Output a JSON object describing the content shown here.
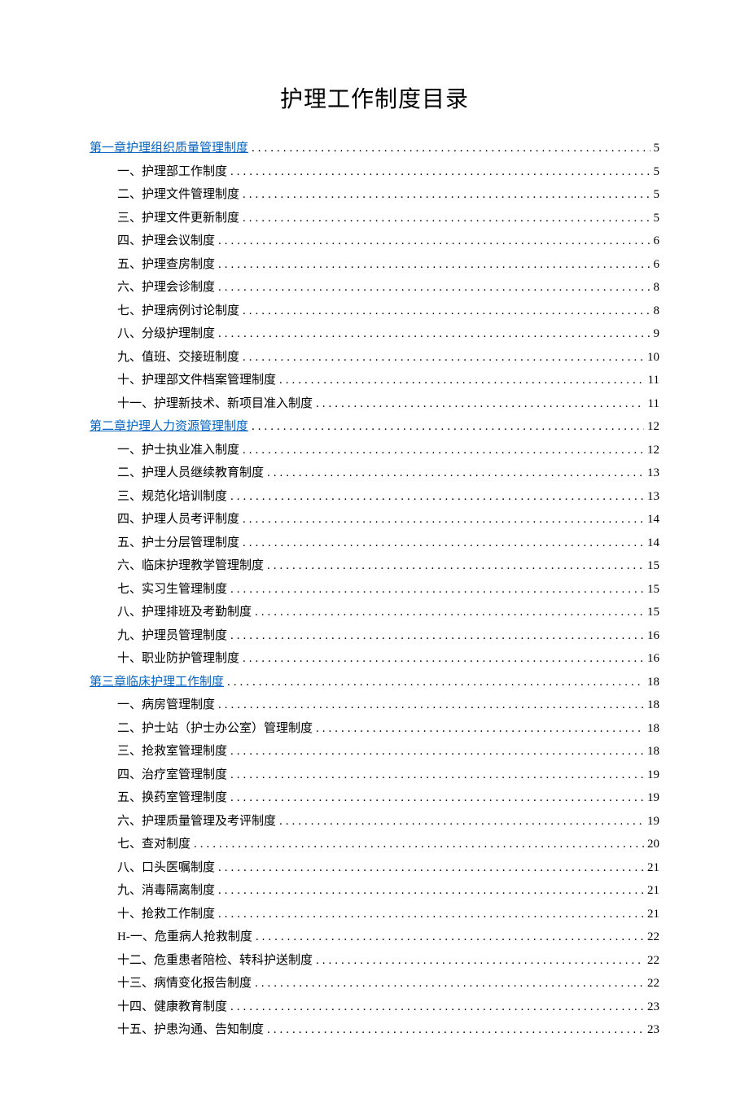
{
  "title": "护理工作制度目录",
  "toc": [
    {
      "level": 1,
      "label": "第一章护理组织质量管理制度",
      "page": "5"
    },
    {
      "level": 2,
      "label": "一、护理部工作制度",
      "page": "5"
    },
    {
      "level": 2,
      "label": "二、护理文件管理制度",
      "page": "5"
    },
    {
      "level": 2,
      "label": "三、护理文件更新制度",
      "page": "5"
    },
    {
      "level": 2,
      "label": "四、护理会议制度",
      "page": "6"
    },
    {
      "level": 2,
      "label": "五、护理查房制度",
      "page": "6"
    },
    {
      "level": 2,
      "label": "六、护理会诊制度",
      "page": "8"
    },
    {
      "level": 2,
      "label": "七、护理病例讨论制度",
      "page": "8"
    },
    {
      "level": 2,
      "label": "八、分级护理制度",
      "page": "9"
    },
    {
      "level": 2,
      "label": "九、值班、交接班制度",
      "page": "10"
    },
    {
      "level": 2,
      "label": "十、护理部文件档案管理制度",
      "page": "11"
    },
    {
      "level": 2,
      "label": "十一、护理新技术、新项目准入制度",
      "page": "11"
    },
    {
      "level": 1,
      "label": "第二章护理人力资源管理制度",
      "page": "12"
    },
    {
      "level": 2,
      "label": "一、护士执业准入制度",
      "page": "12"
    },
    {
      "level": 2,
      "label": "二、护理人员继续教育制度",
      "page": "13"
    },
    {
      "level": 2,
      "label": "三、规范化培训制度",
      "page": "13"
    },
    {
      "level": 2,
      "label": "四、护理人员考评制度",
      "page": "14"
    },
    {
      "level": 2,
      "label": "五、护士分层管理制度",
      "page": "14"
    },
    {
      "level": 2,
      "label": "六、临床护理教学管理制度",
      "page": "15"
    },
    {
      "level": 2,
      "label": "七、实习生管理制度",
      "page": "15"
    },
    {
      "level": 2,
      "label": "八、护理排班及考勤制度",
      "page": "15"
    },
    {
      "level": 2,
      "label": "九、护理员管理制度",
      "page": "16"
    },
    {
      "level": 2,
      "label": "十、职业防护管理制度",
      "page": "16"
    },
    {
      "level": 1,
      "label": "第三章临床护理工作制度",
      "page": "18"
    },
    {
      "level": 2,
      "label": "一、病房管理制度",
      "page": "18"
    },
    {
      "level": 2,
      "label": "二、护士站（护士办公室）管理制度",
      "page": "18"
    },
    {
      "level": 2,
      "label": "三、抢救室管理制度",
      "page": "18"
    },
    {
      "level": 2,
      "label": "四、治疗室管理制度",
      "page": "19"
    },
    {
      "level": 2,
      "label": "五、换药室管理制度",
      "page": "19"
    },
    {
      "level": 2,
      "label": "六、护理质量管理及考评制度",
      "page": "19"
    },
    {
      "level": 2,
      "label": "七、查对制度",
      "page": "20"
    },
    {
      "level": 2,
      "label": "八、口头医嘱制度",
      "page": "21"
    },
    {
      "level": 2,
      "label": "九、消毒隔离制度",
      "page": "21"
    },
    {
      "level": 2,
      "label": "十、抢救工作制度",
      "page": "21"
    },
    {
      "level": 2,
      "label": "H-一、危重病人抢救制度",
      "page": "22"
    },
    {
      "level": 2,
      "label": "十二、危重患者陪检、转科护送制度",
      "page": "22"
    },
    {
      "level": 2,
      "label": "十三、病情变化报告制度",
      "page": "22"
    },
    {
      "level": 2,
      "label": "十四、健康教育制度",
      "page": "23"
    },
    {
      "level": 2,
      "label": "十五、护患沟通、告知制度",
      "page": "23"
    }
  ]
}
